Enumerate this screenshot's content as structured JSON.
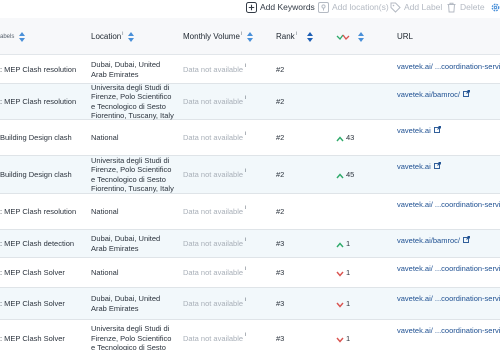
{
  "toolbar": {
    "add_keywords": "Add Keywords",
    "add_locations": "Add location(s)",
    "add_label": "Add Label",
    "delete": "Delete"
  },
  "columns": {
    "labels": "abels",
    "location": "Location",
    "monthly_volume": "Monthly Volume",
    "rank": "Rank",
    "url": "URL",
    "info_mark": "i"
  },
  "rows": [
    {
      "label": ": MEP Clash resolution",
      "location": "Dubai, Dubai, United Arab Emirates",
      "volume": "Data not available",
      "rank": "#2",
      "change": "",
      "direction": "",
      "url": "vavetek.ai/ ...coordination-service",
      "ext": false
    },
    {
      "label": ": MEP Clash resolution",
      "location": "Universita degli Studi di Firenze, Polo Scientifico e Tecnologico di Sesto Fiorentino, Tuscany, Italy",
      "volume": "Data not available",
      "rank": "#2",
      "change": "",
      "direction": "",
      "url": "vavetek.ai/bamroc/",
      "ext": true
    },
    {
      "label": "Building Design clash",
      "location": "National",
      "volume": "Data not available",
      "rank": "#2",
      "change": "43",
      "direction": "up",
      "url": "vavetek.ai",
      "ext": true
    },
    {
      "label": "Building Design clash",
      "location": "Universita degli Studi di Firenze, Polo Scientifico e Tecnologico di Sesto Fiorentino, Tuscany, Italy",
      "volume": "Data not available",
      "rank": "#2",
      "change": "45",
      "direction": "up",
      "url": "vavetek.ai",
      "ext": true
    },
    {
      "label": ": MEP Clash resolution",
      "location": "National",
      "volume": "Data not available",
      "rank": "#2",
      "change": "",
      "direction": "",
      "url": "vavetek.ai/ ...coordination-service",
      "ext": false
    },
    {
      "label": ": MEP Clash detection",
      "location": "Dubai, Dubai, United Arab Emirates",
      "volume": "Data not available",
      "rank": "#3",
      "change": "1",
      "direction": "up",
      "url": "vavetek.ai/bamroc/",
      "ext": true
    },
    {
      "label": ": MEP Clash Solver",
      "location": "National",
      "volume": "Data not available",
      "rank": "#3",
      "change": "1",
      "direction": "down",
      "url": "vavetek.ai/ ...coordination-service",
      "ext": false
    },
    {
      "label": ": MEP Clash Solver",
      "location": "Dubai, Dubai, United Arab Emirates",
      "volume": "Data not available",
      "rank": "#3",
      "change": "1",
      "direction": "down",
      "url": "vavetek.ai/ ...coordination-service",
      "ext": false
    },
    {
      "label": ": MEP Clash Solver",
      "location": "Universita degli Studi di Firenze, Polo Scientifico e Tecnologico di Sesto",
      "volume": "Data not available",
      "rank": "#3",
      "change": "1",
      "direction": "down",
      "url": "vavetek.ai/ ...coordination-service",
      "ext": false
    }
  ],
  "colors": {
    "up": "#2eaa6a",
    "down": "#d9534f",
    "link": "#1d4f91"
  },
  "icons": {
    "add_keywords": "plus-box-icon",
    "add_locations": "location-pin-icon",
    "add_label": "tag-icon",
    "delete": "trash-icon",
    "change_header": "trend-zigzag-icon",
    "external": "external-link-icon"
  }
}
